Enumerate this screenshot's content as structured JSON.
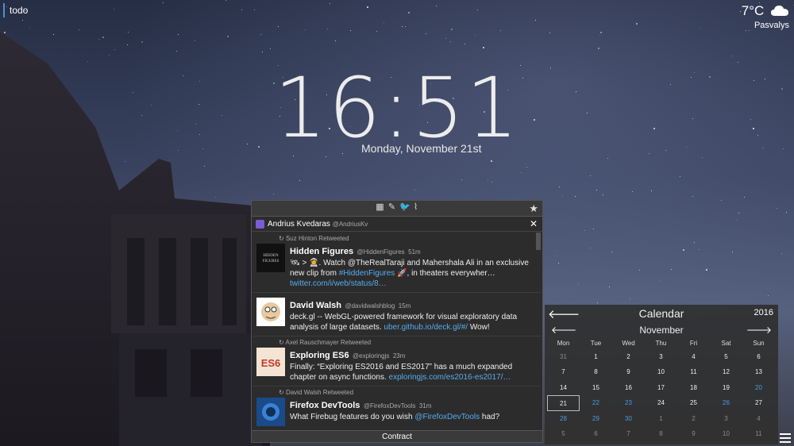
{
  "todo": {
    "label": "todo"
  },
  "weather": {
    "temp": "7°C",
    "icon": "cloud-icon",
    "location": "Pasvalys"
  },
  "clock": {
    "time": "16:51",
    "date": "Monday, November 21st"
  },
  "twitter": {
    "top_icons": [
      "grid-icon",
      "compose-icon",
      "twitter-icon",
      "rss-icon"
    ],
    "favorite_icon": "star-icon",
    "account": {
      "name": "Andrius Kvedaras",
      "handle": "@AndriusKv"
    },
    "tweets": [
      {
        "retweet_by": "Suz Hinton Retweeted",
        "name": "Hidden Figures",
        "handle": "@HiddenFigures",
        "time": "51m",
        "text": "🛰 > 👩‍🚀. Watch @TheRealTaraji and Mahershala Ali in an exclusive new clip from ",
        "link1": "#HiddenFigures",
        "text2": " 🚀, in theaters everywher… ",
        "link2": "twitter.com/i/web/status/8…"
      },
      {
        "retweet_by": "",
        "name": "David Walsh",
        "handle": "@davidwalshblog",
        "time": "15m",
        "text": "deck.gl -- WebGL-powered framework for visual exploratory data analysis of large datasets. ",
        "link1": "uber.github.io/deck.gl/#/",
        "text2": " Wow!",
        "link2": ""
      },
      {
        "retweet_by": "Axel Rauschmayer Retweeted",
        "name": "Exploring ES6",
        "handle": "@exploringjs",
        "time": "23m",
        "text": "Finally: “Exploring ES2016 and ES2017” has a much expanded chapter on async functions. ",
        "link1": "exploringjs.com/es2016-es2017/…",
        "text2": "",
        "link2": ""
      },
      {
        "retweet_by": "David Walsh Retweeted",
        "name": "Firefox DevTools",
        "handle": "@FirefoxDevTools",
        "time": "31m",
        "text": "What Firebug features do you wish ",
        "link1": "@FirefoxDevTools",
        "text2": " had?",
        "link2": ""
      }
    ],
    "contract_label": "Contract"
  },
  "calendar": {
    "title": "Calendar",
    "year": "2016",
    "month": "November",
    "weekdays": [
      "Mon",
      "Tue",
      "Wed",
      "Thu",
      "Fri",
      "Sat",
      "Sun"
    ],
    "weeks": [
      [
        "31",
        "1",
        "2",
        "3",
        "4",
        "5",
        "6"
      ],
      [
        "7",
        "8",
        "9",
        "10",
        "11",
        "12",
        "13"
      ],
      [
        "14",
        "15",
        "16",
        "17",
        "18",
        "19",
        "20"
      ],
      [
        "21",
        "22",
        "23",
        "24",
        "25",
        "26",
        "27"
      ],
      [
        "28",
        "29",
        "30",
        "1",
        "2",
        "3",
        "4"
      ],
      [
        "5",
        "6",
        "7",
        "8",
        "9",
        "10",
        "11"
      ]
    ],
    "today": "21",
    "colors": {
      "weekend_highlight": "#4a9be0",
      "other_month": "#8a8a8a"
    }
  }
}
